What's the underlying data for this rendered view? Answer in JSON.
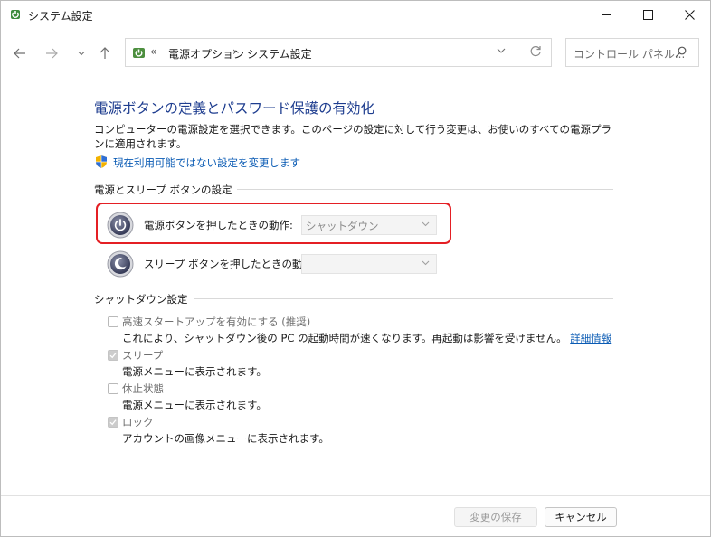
{
  "window": {
    "title": "システム設定"
  },
  "navigation": {
    "breadcrumbs": [
      "電源オプション",
      "システム設定"
    ],
    "search_placeholder": "コントロール パネル..."
  },
  "page": {
    "title": "電源ボタンの定義とパスワード保護の有効化",
    "description": "コンピューターの電源設定を選択できます。このページの設定に対して行う変更は、お使いのすべての電源プランに適用されます。",
    "admin_link": "現在利用可能ではない設定を変更します"
  },
  "power_section": {
    "label": "電源とスリープ ボタンの設定",
    "power_button": {
      "label": "電源ボタンを押したときの動作:",
      "value": "シャットダウン"
    },
    "sleep_button": {
      "label": "スリープ ボタンを押したときの動作:",
      "value": ""
    }
  },
  "shutdown_section": {
    "label": "シャットダウン設定",
    "items": [
      {
        "label": "高速スタートアップを有効にする (推奨)",
        "description": "これにより、シャットダウン後の PC の起動時間が速くなります。再起動は影響を受けません。",
        "link": "詳細情報",
        "checked": false
      },
      {
        "label": "スリープ",
        "description": "電源メニューに表示されます。",
        "checked": true
      },
      {
        "label": "休止状態",
        "description": "電源メニューに表示されます。",
        "checked": false
      },
      {
        "label": "ロック",
        "description": "アカウントの画像メニューに表示されます。",
        "checked": true
      }
    ]
  },
  "footer": {
    "save_label": "変更の保存",
    "cancel_label": "キャンセル"
  },
  "colors": {
    "title_blue": "#1e3d8f",
    "link_blue": "#0a5bb4",
    "highlight_red": "#e41f24"
  }
}
